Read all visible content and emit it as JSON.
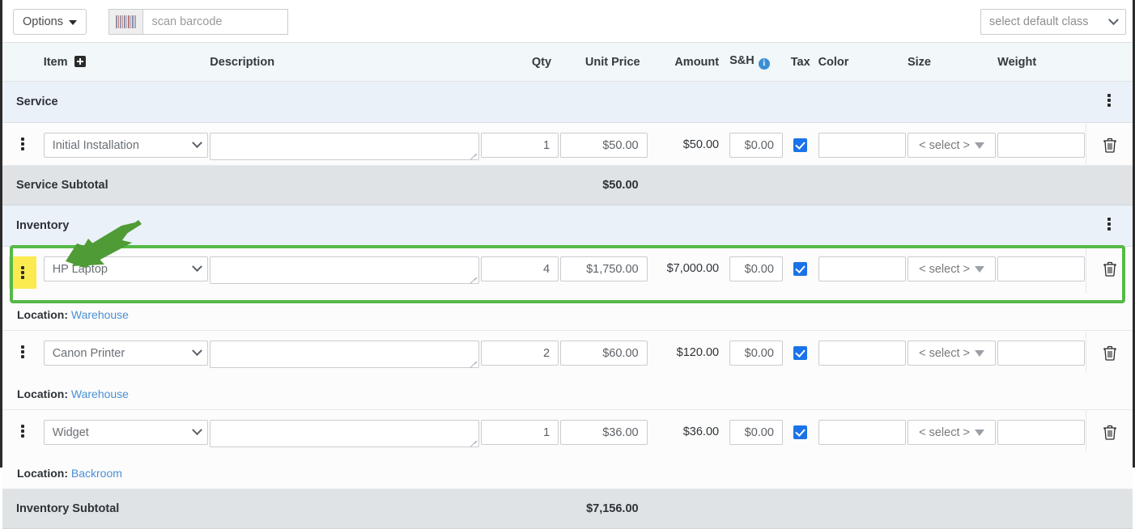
{
  "toolbar": {
    "options_label": "Options",
    "scan_placeholder": "scan barcode",
    "scan_value": "",
    "barcode_icon": "barcode-icon",
    "class_select_value": "select default class"
  },
  "columns": {
    "item": "Item",
    "description": "Description",
    "qty": "Qty",
    "unit_price": "Unit Price",
    "amount": "Amount",
    "sh": "S&H",
    "tax": "Tax",
    "color": "Color",
    "size": "Size",
    "weight": "Weight"
  },
  "sections": [
    {
      "title": "Service",
      "subtotal_label": "Service Subtotal",
      "subtotal_value": "$50.00",
      "rows": [
        {
          "item": "Initial Installation",
          "description": "",
          "qty": "1",
          "unit_price": "$50.00",
          "amount": "$50.00",
          "sh": "$0.00",
          "tax_checked": true,
          "color": "",
          "size": "< select >",
          "weight": "",
          "location_label": "",
          "location_value": "",
          "highlighted": false
        }
      ]
    },
    {
      "title": "Inventory",
      "subtotal_label": "Inventory Subtotal",
      "subtotal_value": "$7,156.00",
      "rows": [
        {
          "item": "HP Laptop",
          "description": "",
          "qty": "4",
          "unit_price": "$1,750.00",
          "amount": "$7,000.00",
          "sh": "$0.00",
          "tax_checked": true,
          "color": "",
          "size": "< select >",
          "weight": "",
          "location_label": "Location:",
          "location_value": "Warehouse",
          "highlighted": true
        },
        {
          "item": "Canon Printer",
          "description": "",
          "qty": "2",
          "unit_price": "$60.00",
          "amount": "$120.00",
          "sh": "$0.00",
          "tax_checked": true,
          "color": "",
          "size": "< select >",
          "weight": "",
          "location_label": "Location:",
          "location_value": "Warehouse",
          "highlighted": false
        },
        {
          "item": "Widget",
          "description": "",
          "qty": "1",
          "unit_price": "$36.00",
          "amount": "$36.00",
          "sh": "$0.00",
          "tax_checked": true,
          "color": "",
          "size": "< select >",
          "weight": "",
          "location_label": "Location:",
          "location_value": "Backroom",
          "highlighted": false
        }
      ]
    }
  ],
  "annotation": {
    "highlight_color": "#55b948",
    "kebab_highlight_color": "#fbeb50",
    "arrow_color": "#4f9b36"
  }
}
